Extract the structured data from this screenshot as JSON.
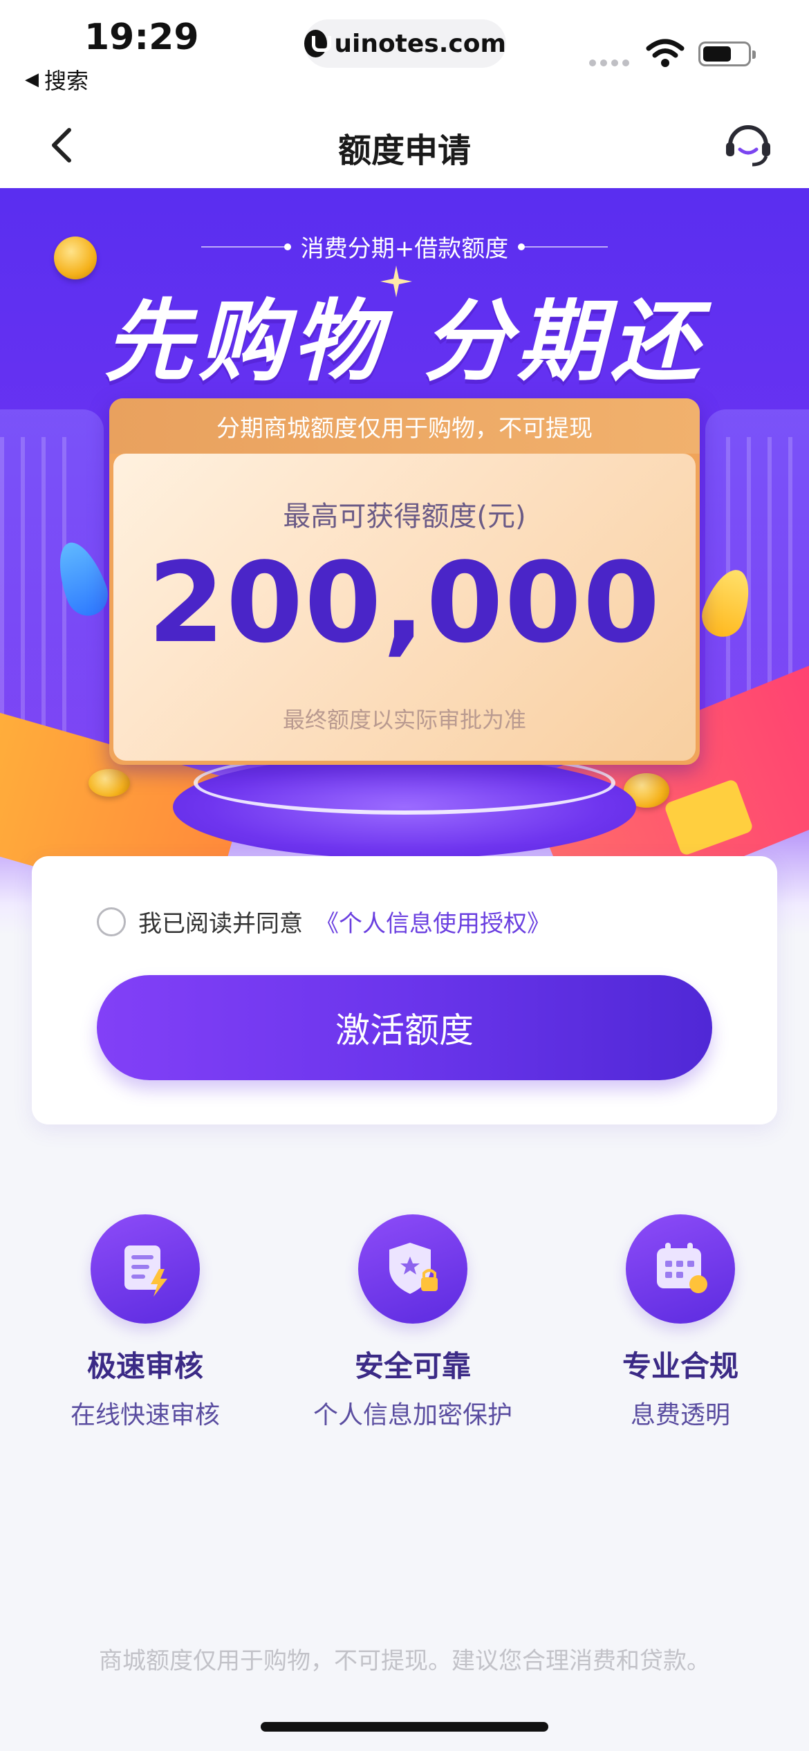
{
  "status_bar": {
    "time": "19:29",
    "back_app": "搜索",
    "url": "uinotes.com"
  },
  "nav": {
    "title": "额度申请",
    "back_icon": "chevron-left-icon",
    "service_icon": "customer-service-icon"
  },
  "hero": {
    "subtitle": "消费分期+借款额度",
    "title": "先购物 分期还",
    "card": {
      "header": "分期商城额度仅用于购物，不可提现",
      "label": "最高可获得额度(元)",
      "amount": "200,000",
      "note": "最终额度以实际审批为准"
    }
  },
  "apply": {
    "agree_text": "我已阅读并同意",
    "agree_link": "《个人信息使用授权》",
    "agree_checked": false,
    "activate_label": "激活额度"
  },
  "features": [
    {
      "icon": "document-lightning-icon",
      "title": "极速审核",
      "subtitle": "在线快速审核"
    },
    {
      "icon": "shield-lock-icon",
      "title": "安全可靠",
      "subtitle": "个人信息加密保护"
    },
    {
      "icon": "calendar-coin-icon",
      "title": "专业合规",
      "subtitle": "息费透明"
    }
  ],
  "footer": {
    "note": "商城额度仅用于购物，不可提现。建议您合理消费和贷款。"
  },
  "colors": {
    "brand_purple": "#6b35ec",
    "amount_purple": "#4a25c8",
    "link_purple": "#6a3fe0",
    "card_orange": "#f0a45a"
  }
}
